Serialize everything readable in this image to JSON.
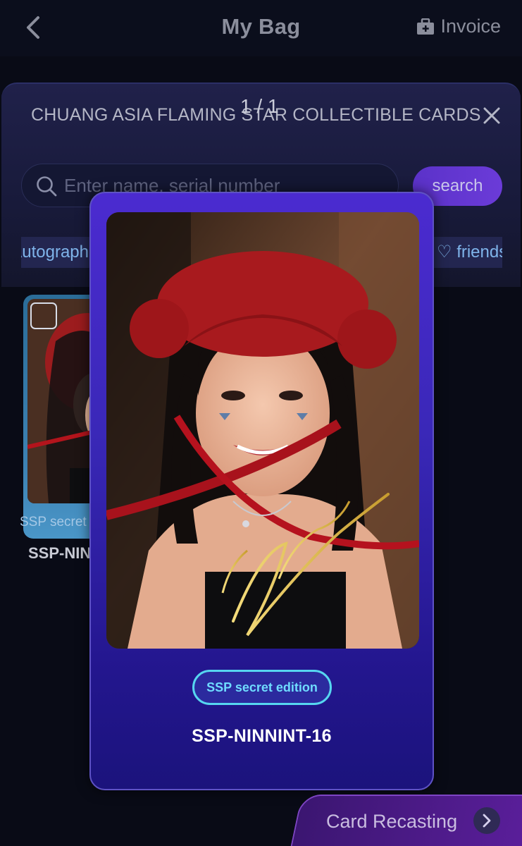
{
  "header": {
    "title": "My Bag",
    "invoice_label": "Invoice"
  },
  "sheet": {
    "title": "CHUANG ASIA FLAMING STAR COLLECTIBLE CARDS",
    "counter": "1 / 1",
    "search": {
      "placeholder": "Enter name, serial number",
      "button_label": "search"
    },
    "filters": [
      "Autograph",
      "friendship"
    ]
  },
  "background_card": {
    "edition": "SSP secret edition",
    "serial": "SSP-NINNINT-16"
  },
  "modal": {
    "edition": "SSP secret edition",
    "serial": "SSP-NINNINT-16",
    "signature": "Ninnint"
  },
  "recast_button": {
    "label": "Card Recasting"
  },
  "colors": {
    "modal_top": "#4b2bd0",
    "modal_bottom": "#1b137c",
    "badge_border": "#56d6f0",
    "search_button": "#6b3bd8"
  }
}
